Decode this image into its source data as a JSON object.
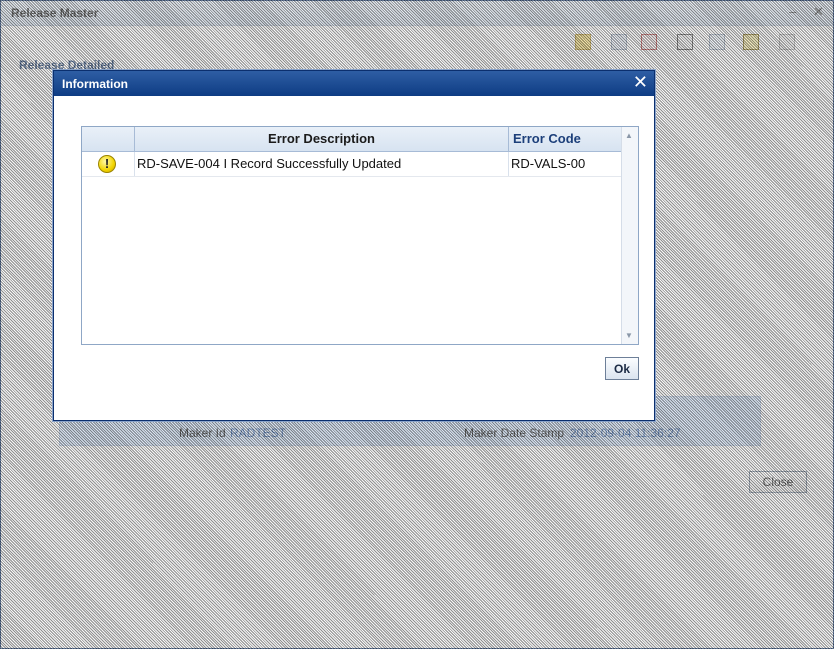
{
  "window": {
    "title": "Release Master",
    "minimize_glyph": "–",
    "close_glyph": "✕",
    "section_label": "Release Detailed",
    "toolbar_icons": [
      "new-icon",
      "copy-icon",
      "delete-icon",
      "print-icon",
      "edit-icon",
      "unlock-icon",
      "help-icon"
    ],
    "maker_id_label": "Maker Id",
    "maker_id_value": "RADTEST",
    "maker_date_label": "Maker Date Stamp",
    "maker_date_value": "2012-09-04 11:36:27",
    "close_label": "Close"
  },
  "dialog": {
    "title": "Information",
    "close_glyph": "✕",
    "columns": {
      "icon": "",
      "description": "Error Description",
      "code": "Error Code"
    },
    "rows": [
      {
        "icon": "warning-icon",
        "icon_glyph": "!",
        "description": "RD-SAVE-004 I Record Successfully Updated",
        "code": "RD-VALS-00"
      }
    ],
    "ok_label": "Ok"
  },
  "colors": {
    "dialog_title_bg": "#0e3c84",
    "header_code_text": "#1c3f7a",
    "warning_fill": "#f2d400"
  }
}
